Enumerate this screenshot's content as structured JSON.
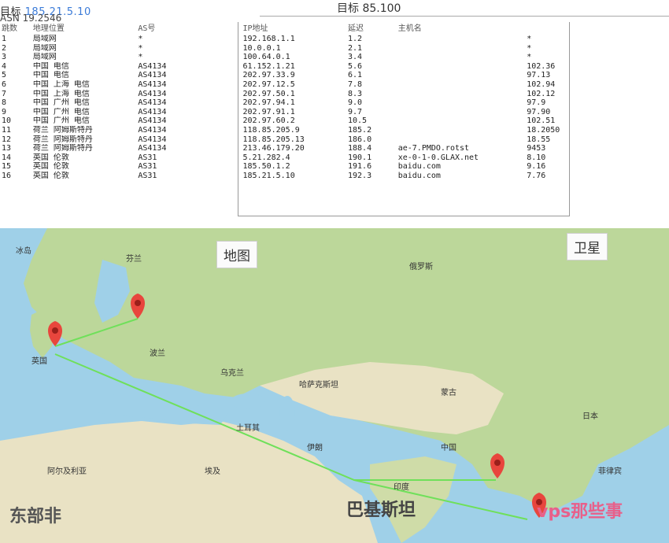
{
  "header": {
    "left_prefix": "目标",
    "left_ip": "185.21.5.10",
    "left_sub": "ASN 19.2546",
    "center": "目标 85.100"
  },
  "trace": {
    "columns": [
      "跳数",
      "地理位置",
      "AS号",
      "IP地址",
      "延迟",
      "主机名"
    ],
    "rows": [
      {
        "hop": "1",
        "geo": "局域网",
        "asn": "*",
        "ip": "192.168.1.1",
        "rtt": "1.2",
        "host": "",
        "extra": "*"
      },
      {
        "hop": "2",
        "geo": "局域网",
        "asn": "*",
        "ip": "10.0.0.1",
        "rtt": "2.1",
        "host": "",
        "extra": "*"
      },
      {
        "hop": "3",
        "geo": "局域网",
        "asn": "*",
        "ip": "100.64.0.1",
        "rtt": "3.4",
        "host": "",
        "extra": "*"
      },
      {
        "hop": "4",
        "geo": "中国 电信",
        "asn": "AS4134",
        "ip": "61.152.1.21",
        "rtt": "5.6",
        "host": "",
        "extra": "102.36"
      },
      {
        "hop": "5",
        "geo": "中国 电信",
        "asn": "AS4134",
        "ip": "202.97.33.9",
        "rtt": "6.1",
        "host": "",
        "extra": "97.13"
      },
      {
        "hop": "6",
        "geo": "中国 上海 电信",
        "asn": "AS4134",
        "ip": "202.97.12.5",
        "rtt": "7.8",
        "host": "",
        "extra": "102.94"
      },
      {
        "hop": "7",
        "geo": "中国 上海 电信",
        "asn": "AS4134",
        "ip": "202.97.50.1",
        "rtt": "8.3",
        "host": "",
        "extra": "102.12"
      },
      {
        "hop": "8",
        "geo": "中国 广州 电信",
        "asn": "AS4134",
        "ip": "202.97.94.1",
        "rtt": "9.0",
        "host": "",
        "extra": "97.9"
      },
      {
        "hop": "9",
        "geo": "中国 广州 电信",
        "asn": "AS4134",
        "ip": "202.97.91.1",
        "rtt": "9.7",
        "host": "",
        "extra": "97.90"
      },
      {
        "hop": "10",
        "geo": "中国 广州 电信",
        "asn": "AS4134",
        "ip": "202.97.60.2",
        "rtt": "10.5",
        "host": "",
        "extra": "102.51"
      },
      {
        "hop": "11",
        "geo": "荷兰 阿姆斯特丹",
        "asn": "AS4134",
        "ip": "118.85.205.9",
        "rtt": "185.2",
        "host": "",
        "extra": "18.2050"
      },
      {
        "hop": "12",
        "geo": "荷兰 阿姆斯特丹",
        "asn": "AS4134",
        "ip": "118.85.205.13",
        "rtt": "186.0",
        "host": "",
        "extra": "18.55"
      },
      {
        "hop": "13",
        "geo": "荷兰 阿姆斯特丹",
        "asn": "AS4134",
        "ip": "213.46.179.20",
        "rtt": "188.4",
        "host": "ae-7.PMDO.rotst",
        "extra": "9453"
      },
      {
        "hop": "14",
        "geo": "英国 伦敦",
        "asn": "AS31",
        "ip": "5.21.282.4",
        "rtt": "190.1",
        "host": "xe-0-1-0.GLAX.net",
        "extra": "8.10"
      },
      {
        "hop": "15",
        "geo": "英国 伦敦",
        "asn": "AS31",
        "ip": "185.50.1.2",
        "rtt": "191.6",
        "host": "baidu.com",
        "extra": "9.16"
      },
      {
        "hop": "16",
        "geo": "英国 伦敦",
        "asn": "AS31",
        "ip": "185.21.5.10",
        "rtt": "192.3",
        "host": "baidu.com",
        "extra": "7.76"
      }
    ]
  },
  "map": {
    "btn_map": "地图",
    "btn_sat": "卫星",
    "places": [
      {
        "text": "冰岛",
        "id": "place-1"
      },
      {
        "text": "芬兰",
        "id": "place-2"
      },
      {
        "text": "俄罗斯",
        "id": "place-3"
      },
      {
        "text": "英国",
        "id": "place-4"
      },
      {
        "text": "波兰",
        "id": "place-5"
      },
      {
        "text": "乌克兰",
        "id": "place-6"
      },
      {
        "text": "哈萨克斯坦",
        "id": "place-7"
      },
      {
        "text": "蒙古",
        "id": "place-8"
      },
      {
        "text": "中国",
        "id": "place-9"
      },
      {
        "text": "日本",
        "id": "place-10"
      },
      {
        "text": "伊朗",
        "id": "place-11"
      },
      {
        "text": "印度",
        "id": "place-12"
      },
      {
        "text": "阿尔及利亚",
        "id": "place-13"
      },
      {
        "text": "埃及",
        "id": "place-14"
      },
      {
        "text": "土耳其",
        "id": "place-15"
      },
      {
        "text": "菲律宾",
        "id": "place-16"
      }
    ],
    "watermarks": {
      "left": "东部非",
      "center": "巴基斯坦",
      "right": "vps那些事"
    },
    "colors": {
      "land": "#bcd79a",
      "desert": "#e9e2c4",
      "sea": "#9fd0e8",
      "route": "#6fe05a",
      "marker": "#e8463d"
    }
  }
}
